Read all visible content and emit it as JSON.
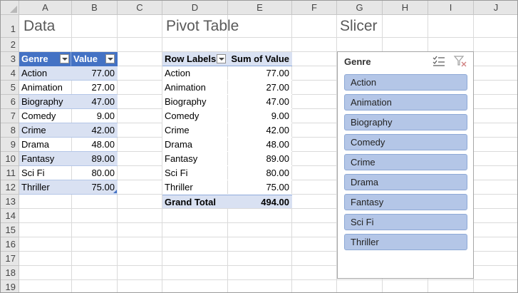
{
  "columns": [
    "A",
    "B",
    "C",
    "D",
    "E",
    "F",
    "G",
    "H",
    "I",
    "J"
  ],
  "rows": [
    "1",
    "2",
    "3",
    "4",
    "5",
    "6",
    "7",
    "8",
    "9",
    "10",
    "11",
    "12",
    "13",
    "14",
    "15",
    "16",
    "17",
    "18",
    "19"
  ],
  "titles": {
    "data": "Data",
    "pivot": "Pivot Table",
    "slicer": "Slicer"
  },
  "data_table": {
    "headers": [
      "Genre",
      "Value"
    ],
    "rows": [
      [
        "Action",
        "77.00"
      ],
      [
        "Animation",
        "27.00"
      ],
      [
        "Biography",
        "47.00"
      ],
      [
        "Comedy",
        "9.00"
      ],
      [
        "Crime",
        "42.00"
      ],
      [
        "Drama",
        "48.00"
      ],
      [
        "Fantasy",
        "89.00"
      ],
      [
        "Sci Fi",
        "80.00"
      ],
      [
        "Thriller",
        "75.00"
      ]
    ]
  },
  "pivot": {
    "headers": [
      "Row Labels",
      "Sum of Value"
    ],
    "rows": [
      [
        "Action",
        "77.00"
      ],
      [
        "Animation",
        "27.00"
      ],
      [
        "Biography",
        "47.00"
      ],
      [
        "Comedy",
        "9.00"
      ],
      [
        "Crime",
        "42.00"
      ],
      [
        "Drama",
        "48.00"
      ],
      [
        "Fantasy",
        "89.00"
      ],
      [
        "Sci Fi",
        "80.00"
      ],
      [
        "Thriller",
        "75.00"
      ]
    ],
    "total_label": "Grand Total",
    "total_value": "494.00"
  },
  "slicer": {
    "title": "Genre",
    "multiselect_icon": "multi-select-icon",
    "clear_filter_icon": "clear-filter-icon",
    "items": [
      "Action",
      "Animation",
      "Biography",
      "Comedy",
      "Crime",
      "Drama",
      "Fantasy",
      "Sci Fi",
      "Thriller"
    ]
  },
  "colors": {
    "table_header": "#4472c4",
    "band": "#d9e1f2",
    "slicer_button": "#b4c6e7",
    "grid": "#dadada"
  }
}
